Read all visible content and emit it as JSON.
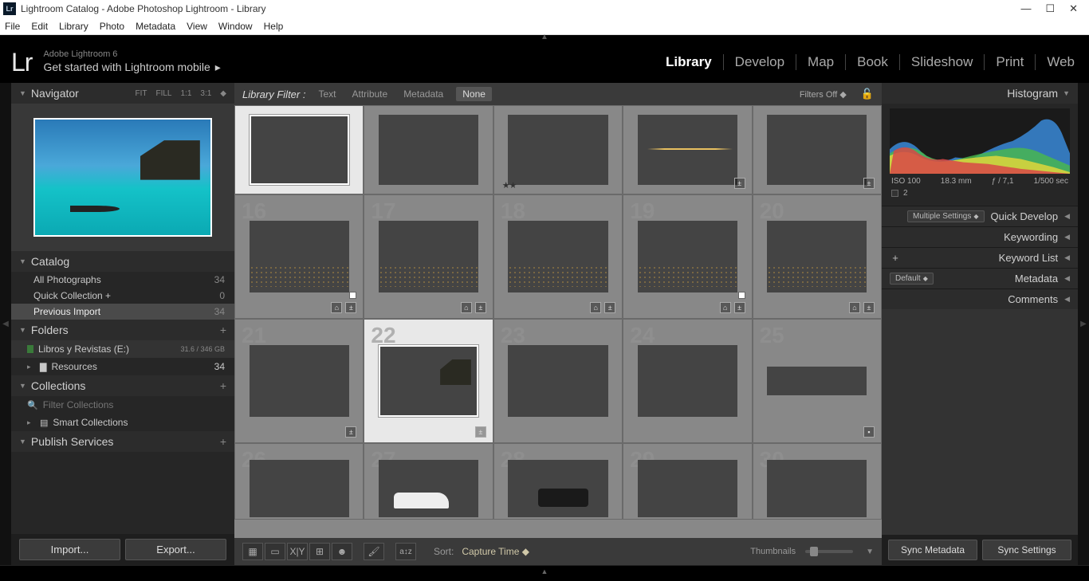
{
  "titlebar": {
    "badge": "Lr",
    "title": "Lightroom Catalog - Adobe Photoshop Lightroom - Library"
  },
  "menubar": [
    "File",
    "Edit",
    "Library",
    "Photo",
    "Metadata",
    "View",
    "Window",
    "Help"
  ],
  "header": {
    "logo": "Lr",
    "line1": "Adobe Lightroom 6",
    "line2": "Get started with Lightroom mobile",
    "modules": [
      "Library",
      "Develop",
      "Map",
      "Book",
      "Slideshow",
      "Print",
      "Web"
    ],
    "active_module": "Library"
  },
  "left": {
    "navigator": {
      "title": "Navigator",
      "opts": [
        "FIT",
        "FILL",
        "1:1",
        "3:1"
      ]
    },
    "catalog": {
      "title": "Catalog",
      "items": [
        {
          "label": "All Photographs",
          "count": 34
        },
        {
          "label": "Quick Collection  +",
          "count": 0
        },
        {
          "label": "Previous Import",
          "count": 34,
          "selected": true
        }
      ]
    },
    "folders": {
      "title": "Folders",
      "volume": {
        "name": "Libros y Revistas (E:)",
        "info": "31.6 / 346 GB"
      },
      "items": [
        {
          "label": "Resources",
          "count": 34
        }
      ]
    },
    "collections": {
      "title": "Collections",
      "filter_placeholder": "Filter Collections",
      "items": [
        {
          "label": "Smart Collections"
        }
      ]
    },
    "publish": {
      "title": "Publish Services"
    },
    "buttons": {
      "import": "Import...",
      "export": "Export..."
    }
  },
  "filterbar": {
    "title": "Library Filter :",
    "tabs": [
      "Text",
      "Attribute",
      "Metadata",
      "None"
    ],
    "selected": "None",
    "filters_label": "Filters Off"
  },
  "grid_start_index": 16,
  "toolbar": {
    "sort_label": "Sort:",
    "sort_value": "Capture Time",
    "thumbs_label": "Thumbnails"
  },
  "right": {
    "histogram": {
      "title": "Histogram",
      "iso": "ISO 100",
      "focal": "18.3 mm",
      "aperture": "ƒ / 7,1",
      "shutter": "1/500 sec",
      "count": "2"
    },
    "quick_develop": {
      "title": "Quick Develop",
      "preset": "Multiple Settings"
    },
    "keywording": {
      "title": "Keywording"
    },
    "keyword_list": {
      "title": "Keyword List"
    },
    "metadata": {
      "title": "Metadata",
      "preset": "Default"
    },
    "comments": {
      "title": "Comments"
    },
    "buttons": {
      "sync_meta": "Sync Metadata",
      "sync_settings": "Sync Settings"
    }
  }
}
